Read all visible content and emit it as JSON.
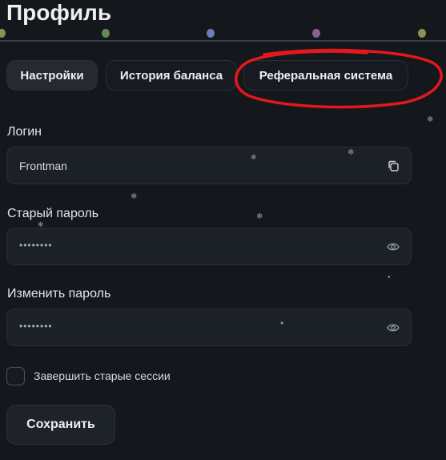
{
  "page_title": "Профиль",
  "tabs": [
    {
      "label": "Настройки",
      "active": true
    },
    {
      "label": "История баланса",
      "active": false
    },
    {
      "label": "Реферальная система",
      "active": false
    }
  ],
  "highlight_color": "#e3181c",
  "garland_colors": [
    "#b9b86a",
    "#7fb06f",
    "#7a8fd8",
    "#b07ab9",
    "#b9b86a"
  ],
  "form": {
    "login_label": "Логин",
    "login_value": "Frontman",
    "old_password_label": "Старый пароль",
    "old_password_value": "••••••••",
    "new_password_label": "Изменить пароль",
    "new_password_value": "••••••••",
    "end_sessions_label": "Завершить старые сессии",
    "end_sessions_checked": false,
    "save_label": "Сохранить"
  },
  "icons": {
    "copy": "copy-icon",
    "eye": "eye-icon",
    "snowflake": "snowflake-icon"
  }
}
